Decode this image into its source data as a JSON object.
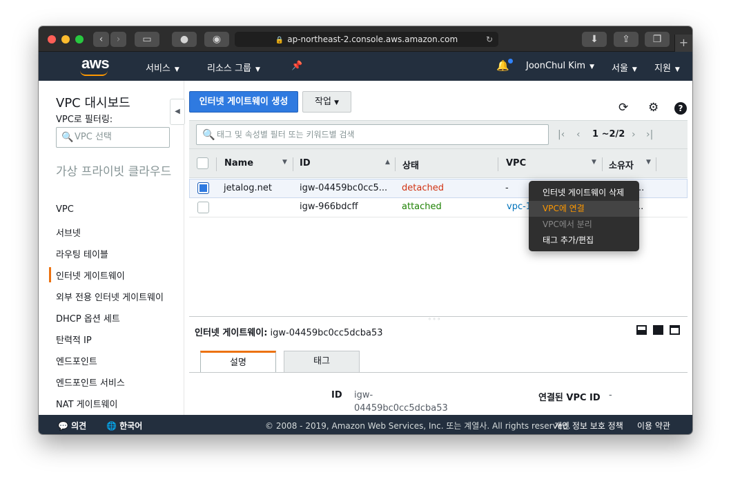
{
  "browser": {
    "url": "ap-northeast-2.console.aws.amazon.com",
    "new_tab": "+"
  },
  "awsnav": {
    "logo": "aws",
    "services": "서비스",
    "resource_groups": "리소스 그룹",
    "user": "JoonChul Kim",
    "region": "서울",
    "support": "지원"
  },
  "sidebar": {
    "title": "VPC 대시보드",
    "filter_label": "VPC로 필터링:",
    "filter_placeholder": "VPC 선택",
    "section": "가상 프라이빗 클라우드",
    "items": [
      {
        "label": "VPC"
      },
      {
        "label": "서브넷"
      },
      {
        "label": "라우팅 테이블"
      },
      {
        "label": "인터넷 게이트웨이"
      },
      {
        "label": "외부 전용 인터넷 게이트웨이"
      },
      {
        "label": "DHCP 옵션 세트"
      },
      {
        "label": "탄력적 IP"
      },
      {
        "label": "엔드포인트"
      },
      {
        "label": "엔드포인트 서비스"
      },
      {
        "label": "NAT 게이트웨이"
      }
    ]
  },
  "toolbar": {
    "create_label": "인터넷 게이트웨이 생성",
    "action_label": "작업"
  },
  "filter": {
    "placeholder": "태그 및 속성별 필터 또는 키워드별 검색",
    "pager_text": "1 ~2/2"
  },
  "table": {
    "columns": [
      "Name",
      "ID",
      "상태",
      "VPC",
      "소유자"
    ],
    "rows": [
      {
        "name": "jetalog.net",
        "id": "igw-04459bc0cc5...",
        "status": "detached",
        "vpc": "-",
        "owner": "..",
        "selected": true
      },
      {
        "name": "",
        "id": "igw-966bdcff",
        "status": "attached",
        "vpc": "vpc-1",
        "owner": "..",
        "selected": false
      }
    ]
  },
  "context_menu": {
    "items": [
      "인터넷 게이트웨이 삭제",
      "VPC에 연결",
      "VPC에서 분리",
      "태그 추가/편집"
    ]
  },
  "details": {
    "title_label": "인터넷 게이트웨이:",
    "title_value": "igw-04459bc0cc5dcba53",
    "tabs": [
      "설명",
      "태그"
    ],
    "id_label": "ID",
    "id_value_line1": "igw-",
    "id_value_line2": "04459bc0cc5dcba53",
    "vpc_label": "연결된 VPC ID",
    "vpc_value": "-"
  },
  "footer": {
    "feedback": "의견",
    "language": "한국어",
    "copyright": "© 2008 - 2019, Amazon Web Services, Inc. 또는 계열사. All rights reserved.",
    "privacy": "개인 정보 보호 정책",
    "terms": "이용 약관"
  },
  "colors": {
    "aws_nav": "#232f3e",
    "accent_orange": "#ec7211",
    "primary_blue": "#2f7ae0",
    "detached_red": "#d13212",
    "attached_green": "#1d8102"
  }
}
